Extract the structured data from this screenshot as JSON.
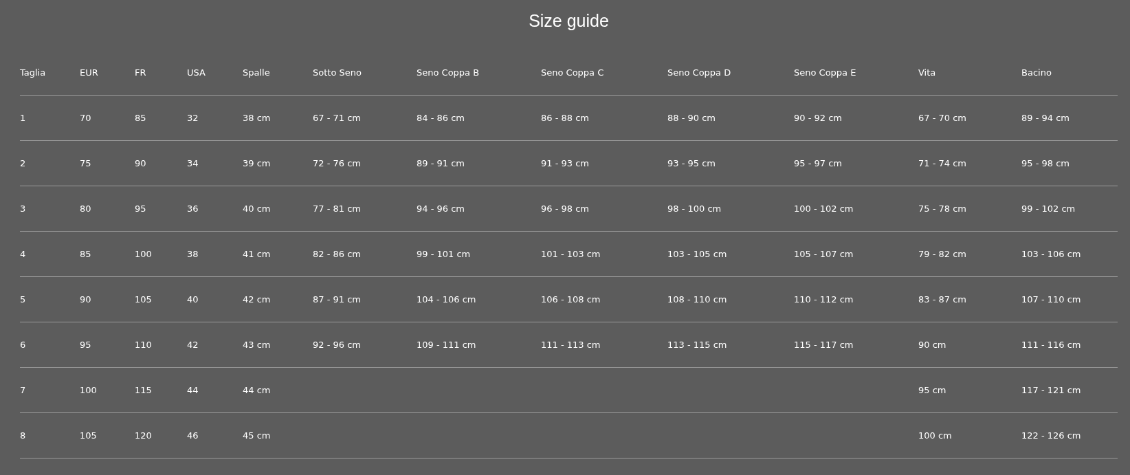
{
  "title": "Size guide",
  "table": {
    "columns": [
      "Taglia",
      "EUR",
      "FR",
      "USA",
      "Spalle",
      "Sotto Seno",
      "Seno Coppa B",
      "Seno Coppa C",
      "Seno Coppa D",
      "Seno Coppa E",
      "Vita",
      "Bacino"
    ],
    "rows": [
      [
        "1",
        "70",
        "85",
        "32",
        "38 cm",
        "67 - 71 cm",
        "84 - 86 cm",
        "86 - 88 cm",
        "88 - 90 cm",
        "90 - 92 cm",
        "67 - 70 cm",
        "89 - 94 cm"
      ],
      [
        "2",
        "75",
        "90",
        "34",
        "39 cm",
        "72 - 76 cm",
        "89 - 91 cm",
        "91 - 93 cm",
        "93 - 95 cm",
        "95 - 97 cm",
        "71 - 74 cm",
        "95 - 98 cm"
      ],
      [
        "3",
        "80",
        "95",
        "36",
        "40 cm",
        "77 - 81 cm",
        "94 - 96 cm",
        "96 - 98 cm",
        "98 - 100 cm",
        "100 - 102 cm",
        "75 - 78 cm",
        "99 - 102 cm"
      ],
      [
        "4",
        "85",
        "100",
        "38",
        "41 cm",
        "82 - 86 cm",
        "99 - 101 cm",
        "101 - 103 cm",
        "103 - 105 cm",
        "105 - 107 cm",
        "79 - 82 cm",
        "103 - 106 cm"
      ],
      [
        "5",
        "90",
        "105",
        "40",
        "42 cm",
        "87 - 91 cm",
        "104 - 106 cm",
        "106 - 108 cm",
        "108 - 110 cm",
        "110 - 112 cm",
        "83 - 87 cm",
        "107 - 110 cm"
      ],
      [
        "6",
        "95",
        "110",
        "42",
        "43 cm",
        "92 - 96 cm",
        "109 - 111 cm",
        "111 - 113 cm",
        "113 - 115 cm",
        "115 - 117 cm",
        "90 cm",
        "111 - 116 cm"
      ],
      [
        "7",
        "100",
        "115",
        "44",
        "44 cm",
        null,
        null,
        null,
        null,
        null,
        "95 cm",
        "117 - 121 cm"
      ],
      [
        "8",
        "105",
        "120",
        "46",
        "45 cm",
        null,
        null,
        null,
        null,
        null,
        "100 cm",
        "122 - 126 cm"
      ]
    ]
  }
}
